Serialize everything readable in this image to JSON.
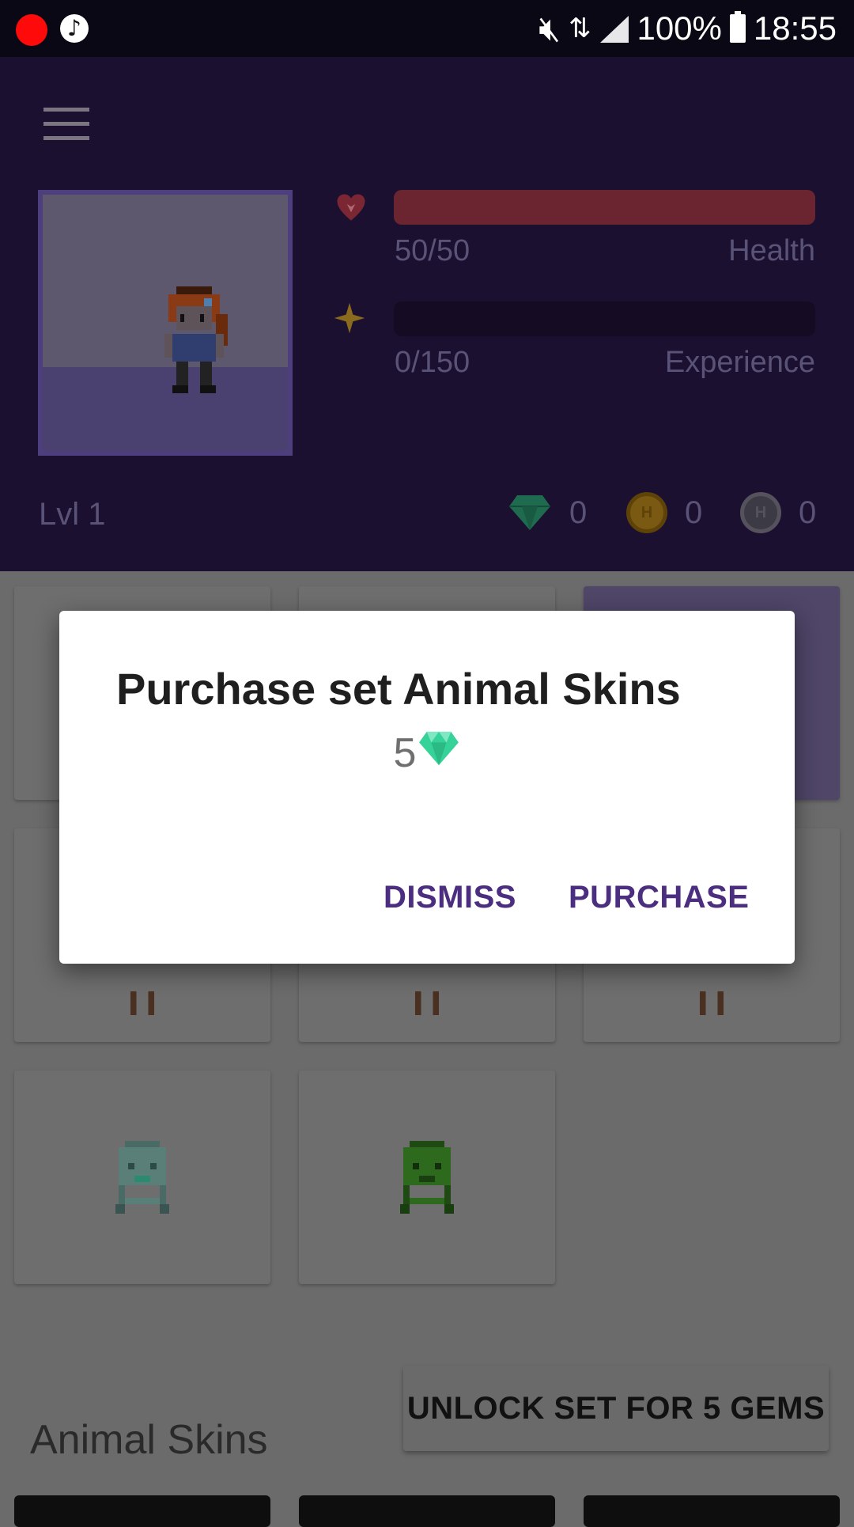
{
  "status_bar": {
    "battery": "100%",
    "time": "18:55",
    "icons": [
      "record-dot-icon",
      "music-icon",
      "mute-icon",
      "wifi-icon",
      "signal-icon",
      "battery-icon"
    ]
  },
  "header": {
    "menu_icon": "hamburger-icon",
    "health": {
      "value": "50/50",
      "label": "Health",
      "fraction": 1.0,
      "color": "#6b2530"
    },
    "experience": {
      "value": "0/150",
      "label": "Experience",
      "fraction": 0.0
    },
    "level": "Lvl 1",
    "currencies": {
      "gems": "0",
      "gold": "0",
      "hourglasses": "0"
    },
    "background_color": "#1c1030"
  },
  "dialog": {
    "title": "Purchase set Animal Skins",
    "price": "5",
    "price_icon": "gem-icon",
    "dismiss_label": "DISMISS",
    "purchase_label": "PURCHASE",
    "button_color": "#4c2e80"
  },
  "content": {
    "unlock_button_label": "UNLOCK SET FOR 5 GEMS",
    "section_title": "Animal Skins"
  }
}
